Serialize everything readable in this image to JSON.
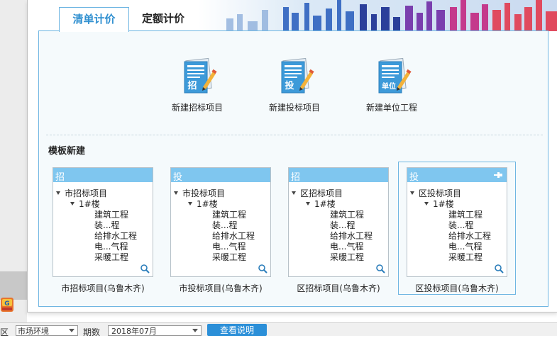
{
  "tabs": [
    {
      "label": "清单计价"
    },
    {
      "label": "定额计价"
    }
  ],
  "new_items": [
    {
      "badge": "招",
      "label": "新建招标项目"
    },
    {
      "badge": "投",
      "label": "新建投标项目"
    },
    {
      "badge": "单位",
      "label": "新建单位工程"
    }
  ],
  "template_section": {
    "title": "模板新建"
  },
  "templates": [
    {
      "tag": "招",
      "root": "市招标项目",
      "child": "1#楼",
      "leaves": [
        "建筑工程",
        "装...程",
        "给排水工程",
        "电...气程",
        "采暖工程"
      ],
      "caption": "市招标项目(乌鲁木齐)"
    },
    {
      "tag": "投",
      "root": "市投标项目",
      "child": "1#楼",
      "leaves": [
        "建筑工程",
        "装...程",
        "给排水工程",
        "电...气程",
        "采暖工程"
      ],
      "caption": "市投标项目(乌鲁木齐)"
    },
    {
      "tag": "招",
      "root": "区招标项目",
      "child": "1#楼",
      "leaves": [
        "建筑工程",
        "装...程",
        "给排水工程",
        "电...气程",
        "采暖工程"
      ],
      "caption": "区招标项目(乌鲁木齐)"
    },
    {
      "tag": "投",
      "root": "区投标项目",
      "child": "1#楼",
      "leaves": [
        "建筑工程",
        "装...程",
        "给排水工程",
        "电...气程",
        "采暖工程"
      ],
      "caption": "区投标项目(乌鲁木齐)"
    }
  ],
  "bottom_bar": {
    "label1": "区",
    "select1": "市场环境",
    "label2": "期数",
    "select2": "2018年07月",
    "button": "查看说明"
  },
  "colors": {
    "accent": "#2f8fd0",
    "card_header": "#7fc6ef",
    "panel_bg": "#f5fafc"
  }
}
